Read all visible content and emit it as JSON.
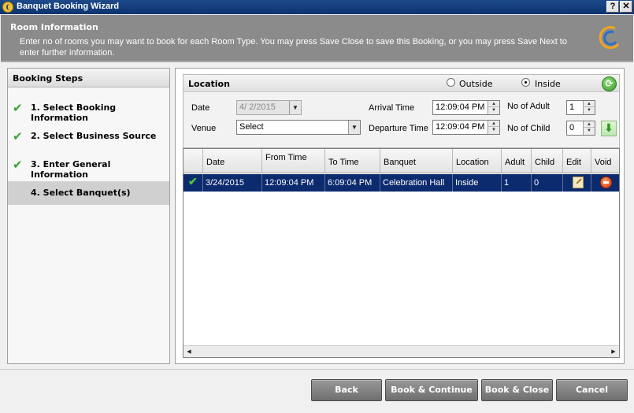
{
  "window": {
    "title": "Banquet Booking Wizard",
    "help_label": "?",
    "close_label": "✕"
  },
  "header": {
    "title": "Room Information",
    "description": "Enter no of rooms you may want to book for each Room Type. You may press Save  Close to save this Booking, or you may press Save  Next to enter further information."
  },
  "steps": {
    "heading": "Booking Steps",
    "items": [
      {
        "label": "1.  Select Booking Information",
        "done": true
      },
      {
        "label": "2.  Select Business Source",
        "done": true
      },
      {
        "label": "3.  Enter General Information",
        "done": true
      },
      {
        "label": "4.  Select Banquet(s)",
        "done": false
      }
    ]
  },
  "location": {
    "heading": "Location",
    "outside_label": "Outside",
    "inside_label": "Inside",
    "selected": "Inside",
    "date_label": "Date",
    "date_value": "4/  2/2015",
    "venue_label": "Venue",
    "venue_value": "Select",
    "arrival_label": "Arrival Time",
    "arrival_value": "12:09:04 PM",
    "departure_label": "Departure Time",
    "departure_value": "12:09:04 PM",
    "adult_label": "No of Adult",
    "adult_value": "1",
    "child_label": "No of Child",
    "child_value": "0"
  },
  "grid": {
    "columns": [
      "Date",
      "From Time",
      "To Time",
      "Banquet",
      "Location",
      "Adult",
      "Child",
      "Edit",
      "Void"
    ],
    "rows": [
      {
        "date": "3/24/2015",
        "from": "12:09:04 PM",
        "to": "6:09:04 PM",
        "banquet": "Celebration Hall",
        "location": "Inside",
        "adult": "1",
        "child": "0"
      }
    ]
  },
  "buttons": {
    "back": "Back",
    "book_continue": "Book & Continue",
    "book_close": "Book & Close",
    "cancel": "Cancel"
  },
  "colors": {
    "title_bar": "#0c3370",
    "header_bg": "#8b8b8b",
    "selected_row": "#0c2a6e",
    "check_green": "#3aa033"
  },
  "icons": [
    "app-logo-icon",
    "check-icon",
    "refresh-icon",
    "add-icon",
    "edit-icon",
    "void-icon",
    "scroll-left-icon",
    "scroll-right-icon"
  ]
}
